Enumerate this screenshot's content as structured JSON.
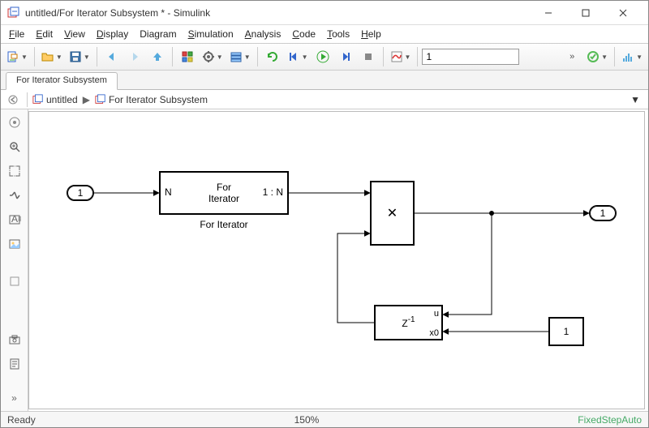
{
  "window": {
    "title": "untitled/For Iterator Subsystem * - Simulink"
  },
  "menu": {
    "file": "File",
    "file_u": "F",
    "edit": "Edit",
    "edit_u": "E",
    "view": "View",
    "view_u": "V",
    "display": "Display",
    "display_u": "D",
    "diagram": "Diagram",
    "diagram_u": "g",
    "simulation": "Simulation",
    "simulation_u": "S",
    "analysis": "Analysis",
    "analysis_u": "A",
    "code": "Code",
    "code_u": "C",
    "tools": "Tools",
    "tools_u": "T",
    "help": "Help",
    "help_u": "H"
  },
  "toolbar": {
    "stoptime": "1"
  },
  "tabs": {
    "active": "For Iterator Subsystem"
  },
  "breadcrumb": {
    "root": "untitled",
    "sub": "For Iterator Subsystem"
  },
  "blocks": {
    "inport_num": "1",
    "foriter_line1": "For",
    "foriter_line2": "Iterator",
    "foriter_port_n": "N",
    "foriter_port_1n": "1 : N",
    "foriter_label": "For Iterator",
    "product_sym": "✕",
    "delay_sym_base": "Z",
    "delay_sym_exp": "-1",
    "delay_port_u": "u",
    "delay_port_x0": "x0",
    "ic_value": "1",
    "outport_num": "1"
  },
  "status": {
    "ready": "Ready",
    "zoom": "150%",
    "solver": "FixedStepAuto"
  }
}
